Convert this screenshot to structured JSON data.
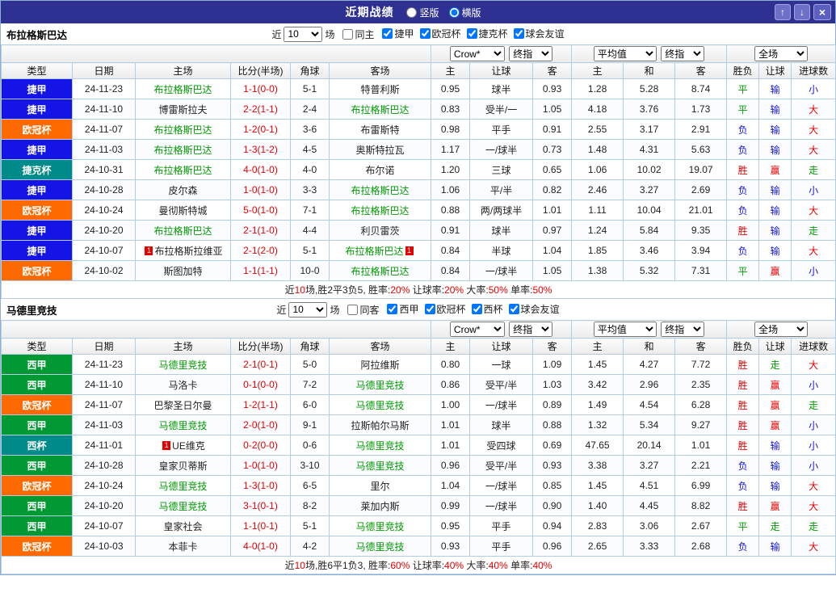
{
  "topbar": {
    "title": "近期战绩",
    "radios": [
      {
        "label": "竖版",
        "checked": false
      },
      {
        "label": "横版",
        "checked": true
      }
    ],
    "up_icon": "↑",
    "down_icon": "↓",
    "close_icon": "×"
  },
  "dropdowns": {
    "crow": "Crow*",
    "final1": "终指",
    "avg": "平均值",
    "final2": "终指",
    "full": "全场"
  },
  "columns": {
    "type": "类型",
    "date": "日期",
    "home": "主场",
    "score": "比分(半场)",
    "corner": "角球",
    "away": "客场",
    "odds_home": "主",
    "handicap": "让球",
    "odds_away": "客",
    "avg_home": "主",
    "avg_draw": "和",
    "avg_away": "客",
    "wl": "胜负",
    "hc": "让球",
    "goals": "进球数"
  },
  "sections": [
    {
      "team": "布拉格斯巴达",
      "filter": {
        "near_label": "近",
        "games_value": "10",
        "games_label": "场",
        "same_label": "同主",
        "same_checked": false,
        "leagues": [
          {
            "label": "捷甲",
            "checked": true
          },
          {
            "label": "欧冠杯",
            "checked": true
          },
          {
            "label": "捷克杯",
            "checked": true
          },
          {
            "label": "球会友谊",
            "checked": true
          }
        ]
      },
      "rows": [
        {
          "league": "捷甲",
          "league_color": "#1414e6",
          "date": "24-11-23",
          "home": "布拉格斯巴达",
          "home_subject": true,
          "score": "1-1(0-0)",
          "corner": "5-1",
          "away": "特普利斯",
          "away_subject": false,
          "odds_home": "0.95",
          "handicap": "球半",
          "odds_away": "0.93",
          "avg_home": "1.28",
          "avg_draw": "5.28",
          "avg_away": "8.74",
          "wl": "平",
          "wl_color": "green",
          "hc": "输",
          "hc_color": "blue",
          "goals": "小",
          "goals_color": "blue"
        },
        {
          "league": "捷甲",
          "league_color": "#1414e6",
          "date": "24-11-10",
          "home": "博雷斯拉夫",
          "home_subject": false,
          "score": "2-2(1-1)",
          "corner": "2-4",
          "away": "布拉格斯巴达",
          "away_subject": true,
          "odds_home": "0.83",
          "handicap": "受半/一",
          "odds_away": "1.05",
          "avg_home": "4.18",
          "avg_draw": "3.76",
          "avg_away": "1.73",
          "wl": "平",
          "wl_color": "green",
          "hc": "输",
          "hc_color": "blue",
          "goals": "大",
          "goals_color": "red"
        },
        {
          "league": "欧冠杯",
          "league_color": "#ff6a00",
          "date": "24-11-07",
          "home": "布拉格斯巴达",
          "home_subject": true,
          "score": "1-2(0-1)",
          "corner": "3-6",
          "away": "布雷斯特",
          "away_subject": false,
          "odds_home": "0.98",
          "handicap": "平手",
          "odds_away": "0.91",
          "avg_home": "2.55",
          "avg_draw": "3.17",
          "avg_away": "2.91",
          "wl": "负",
          "wl_color": "blue",
          "hc": "输",
          "hc_color": "blue",
          "goals": "大",
          "goals_color": "red"
        },
        {
          "league": "捷甲",
          "league_color": "#1414e6",
          "date": "24-11-03",
          "home": "布拉格斯巴达",
          "home_subject": true,
          "score": "1-3(1-2)",
          "corner": "4-5",
          "away": "奥斯特拉瓦",
          "away_subject": false,
          "odds_home": "1.17",
          "handicap": "一/球半",
          "odds_away": "0.73",
          "avg_home": "1.48",
          "avg_draw": "4.31",
          "avg_away": "5.63",
          "wl": "负",
          "wl_color": "blue",
          "hc": "输",
          "hc_color": "blue",
          "goals": "大",
          "goals_color": "red"
        },
        {
          "league": "捷克杯",
          "league_color": "#008b8b",
          "date": "24-10-31",
          "home": "布拉格斯巴达",
          "home_subject": true,
          "score": "4-0(1-0)",
          "corner": "4-0",
          "away": "布尔诺",
          "away_subject": false,
          "odds_home": "1.20",
          "handicap": "三球",
          "odds_away": "0.65",
          "avg_home": "1.06",
          "avg_draw": "10.02",
          "avg_away": "19.07",
          "wl": "胜",
          "wl_color": "red",
          "hc": "赢",
          "hc_color": "red",
          "goals": "走",
          "goals_color": "green"
        },
        {
          "league": "捷甲",
          "league_color": "#1414e6",
          "date": "24-10-28",
          "home": "皮尔森",
          "home_subject": false,
          "score": "1-0(1-0)",
          "corner": "3-3",
          "away": "布拉格斯巴达",
          "away_subject": true,
          "odds_home": "1.06",
          "handicap": "平/半",
          "odds_away": "0.82",
          "avg_home": "2.46",
          "avg_draw": "3.27",
          "avg_away": "2.69",
          "wl": "负",
          "wl_color": "blue",
          "hc": "输",
          "hc_color": "blue",
          "goals": "小",
          "goals_color": "blue"
        },
        {
          "league": "欧冠杯",
          "league_color": "#ff6a00",
          "date": "24-10-24",
          "home": "曼彻斯特城",
          "home_subject": false,
          "score": "5-0(1-0)",
          "corner": "7-1",
          "away": "布拉格斯巴达",
          "away_subject": true,
          "odds_home": "0.88",
          "handicap": "两/两球半",
          "odds_away": "1.01",
          "avg_home": "1.11",
          "avg_draw": "10.04",
          "avg_away": "21.01",
          "wl": "负",
          "wl_color": "blue",
          "hc": "输",
          "hc_color": "blue",
          "goals": "大",
          "goals_color": "red"
        },
        {
          "league": "捷甲",
          "league_color": "#1414e6",
          "date": "24-10-20",
          "home": "布拉格斯巴达",
          "home_subject": true,
          "score": "2-1(1-0)",
          "corner": "4-4",
          "away": "利贝雷茨",
          "away_subject": false,
          "odds_home": "0.91",
          "handicap": "球半",
          "odds_away": "0.97",
          "avg_home": "1.24",
          "avg_draw": "5.84",
          "avg_away": "9.35",
          "wl": "胜",
          "wl_color": "red",
          "hc": "输",
          "hc_color": "blue",
          "goals": "走",
          "goals_color": "green"
        },
        {
          "league": "捷甲",
          "league_color": "#1414e6",
          "date": "24-10-07",
          "home": "布拉格斯拉维亚",
          "home_subject": false,
          "home_badge_before": "1",
          "score": "2-1(2-0)",
          "corner": "5-1",
          "away": "布拉格斯巴达",
          "away_subject": true,
          "away_badge_after": "1",
          "odds_home": "0.84",
          "handicap": "半球",
          "odds_away": "1.04",
          "avg_home": "1.85",
          "avg_draw": "3.46",
          "avg_away": "3.94",
          "wl": "负",
          "wl_color": "blue",
          "hc": "输",
          "hc_color": "blue",
          "goals": "大",
          "goals_color": "red"
        },
        {
          "league": "欧冠杯",
          "league_color": "#ff6a00",
          "date": "24-10-02",
          "home": "斯图加特",
          "home_subject": false,
          "score": "1-1(1-1)",
          "corner": "10-0",
          "away": "布拉格斯巴达",
          "away_subject": true,
          "odds_home": "0.84",
          "handicap": "一/球半",
          "odds_away": "1.05",
          "avg_home": "1.38",
          "avg_draw": "5.32",
          "avg_away": "7.31",
          "wl": "平",
          "wl_color": "green",
          "hc": "赢",
          "hc_color": "red",
          "goals": "小",
          "goals_color": "blue"
        }
      ],
      "summary": [
        {
          "text": "近",
          "red": false
        },
        {
          "text": "10",
          "red": true
        },
        {
          "text": "场,胜2平3负5, 胜率:",
          "red": false
        },
        {
          "text": "20%",
          "red": true
        },
        {
          "text": " 让球率:",
          "red": false
        },
        {
          "text": "20%",
          "red": true
        },
        {
          "text": " 大率:",
          "red": false
        },
        {
          "text": "50%",
          "red": true
        },
        {
          "text": " 单率:",
          "red": false
        },
        {
          "text": "50%",
          "red": true
        }
      ]
    },
    {
      "team": "马德里竞技",
      "filter": {
        "near_label": "近",
        "games_value": "10",
        "games_label": "场",
        "same_label": "同客",
        "same_checked": false,
        "leagues": [
          {
            "label": "西甲",
            "checked": true
          },
          {
            "label": "欧冠杯",
            "checked": true
          },
          {
            "label": "西杯",
            "checked": true
          },
          {
            "label": "球会友谊",
            "checked": true
          }
        ]
      },
      "rows": [
        {
          "league": "西甲",
          "league_color": "#009933",
          "date": "24-11-23",
          "home": "马德里竞技",
          "home_subject": true,
          "score": "2-1(0-1)",
          "corner": "5-0",
          "away": "阿拉维斯",
          "away_subject": false,
          "odds_home": "0.80",
          "handicap": "一球",
          "odds_away": "1.09",
          "avg_home": "1.45",
          "avg_draw": "4.27",
          "avg_away": "7.72",
          "wl": "胜",
          "wl_color": "red",
          "hc": "走",
          "hc_color": "green",
          "goals": "大",
          "goals_color": "red"
        },
        {
          "league": "西甲",
          "league_color": "#009933",
          "date": "24-11-10",
          "home": "马洛卡",
          "home_subject": false,
          "score": "0-1(0-0)",
          "corner": "7-2",
          "away": "马德里竞技",
          "away_subject": true,
          "odds_home": "0.86",
          "handicap": "受平/半",
          "odds_away": "1.03",
          "avg_home": "3.42",
          "avg_draw": "2.96",
          "avg_away": "2.35",
          "wl": "胜",
          "wl_color": "red",
          "hc": "赢",
          "hc_color": "red",
          "goals": "小",
          "goals_color": "blue"
        },
        {
          "league": "欧冠杯",
          "league_color": "#ff6a00",
          "date": "24-11-07",
          "home": "巴黎圣日尔曼",
          "home_subject": false,
          "score": "1-2(1-1)",
          "corner": "6-0",
          "away": "马德里竞技",
          "away_subject": true,
          "odds_home": "1.00",
          "handicap": "一/球半",
          "odds_away": "0.89",
          "avg_home": "1.49",
          "avg_draw": "4.54",
          "avg_away": "6.28",
          "wl": "胜",
          "wl_color": "red",
          "hc": "赢",
          "hc_color": "red",
          "goals": "走",
          "goals_color": "green"
        },
        {
          "league": "西甲",
          "league_color": "#009933",
          "date": "24-11-03",
          "home": "马德里竞技",
          "home_subject": true,
          "score": "2-0(1-0)",
          "corner": "9-1",
          "away": "拉斯帕尔马斯",
          "away_subject": false,
          "odds_home": "1.01",
          "handicap": "球半",
          "odds_away": "0.88",
          "avg_home": "1.32",
          "avg_draw": "5.34",
          "avg_away": "9.27",
          "wl": "胜",
          "wl_color": "red",
          "hc": "赢",
          "hc_color": "red",
          "goals": "小",
          "goals_color": "blue"
        },
        {
          "league": "西杯",
          "league_color": "#008b8b",
          "date": "24-11-01",
          "home": "UE维克",
          "home_subject": false,
          "home_badge_before": "1",
          "score": "0-2(0-0)",
          "corner": "0-6",
          "away": "马德里竞技",
          "away_subject": true,
          "odds_home": "1.01",
          "handicap": "受四球",
          "odds_away": "0.69",
          "avg_home": "47.65",
          "avg_draw": "20.14",
          "avg_away": "1.01",
          "wl": "胜",
          "wl_color": "red",
          "hc": "输",
          "hc_color": "blue",
          "goals": "小",
          "goals_color": "blue"
        },
        {
          "league": "西甲",
          "league_color": "#009933",
          "date": "24-10-28",
          "home": "皇家贝蒂斯",
          "home_subject": false,
          "score": "1-0(1-0)",
          "corner": "3-10",
          "away": "马德里竞技",
          "away_subject": true,
          "odds_home": "0.96",
          "handicap": "受平/半",
          "odds_away": "0.93",
          "avg_home": "3.38",
          "avg_draw": "3.27",
          "avg_away": "2.21",
          "wl": "负",
          "wl_color": "blue",
          "hc": "输",
          "hc_color": "blue",
          "goals": "小",
          "goals_color": "blue"
        },
        {
          "league": "欧冠杯",
          "league_color": "#ff6a00",
          "date": "24-10-24",
          "home": "马德里竞技",
          "home_subject": true,
          "score": "1-3(1-0)",
          "corner": "6-5",
          "away": "里尔",
          "away_subject": false,
          "odds_home": "1.04",
          "handicap": "一/球半",
          "odds_away": "0.85",
          "avg_home": "1.45",
          "avg_draw": "4.51",
          "avg_away": "6.99",
          "wl": "负",
          "wl_color": "blue",
          "hc": "输",
          "hc_color": "blue",
          "goals": "大",
          "goals_color": "red"
        },
        {
          "league": "西甲",
          "league_color": "#009933",
          "date": "24-10-20",
          "home": "马德里竞技",
          "home_subject": true,
          "score": "3-1(0-1)",
          "corner": "8-2",
          "away": "莱加内斯",
          "away_subject": false,
          "odds_home": "0.99",
          "handicap": "一/球半",
          "odds_away": "0.90",
          "avg_home": "1.40",
          "avg_draw": "4.45",
          "avg_away": "8.82",
          "wl": "胜",
          "wl_color": "red",
          "hc": "赢",
          "hc_color": "red",
          "goals": "大",
          "goals_color": "red"
        },
        {
          "league": "西甲",
          "league_color": "#009933",
          "date": "24-10-07",
          "home": "皇家社会",
          "home_subject": false,
          "score": "1-1(0-1)",
          "corner": "5-1",
          "away": "马德里竞技",
          "away_subject": true,
          "odds_home": "0.95",
          "handicap": "平手",
          "odds_away": "0.94",
          "avg_home": "2.83",
          "avg_draw": "3.06",
          "avg_away": "2.67",
          "wl": "平",
          "wl_color": "green",
          "hc": "走",
          "hc_color": "green",
          "goals": "走",
          "goals_color": "green"
        },
        {
          "league": "欧冠杯",
          "league_color": "#ff6a00",
          "date": "24-10-03",
          "home": "本菲卡",
          "home_subject": false,
          "score": "4-0(1-0)",
          "corner": "4-2",
          "away": "马德里竞技",
          "away_subject": true,
          "odds_home": "0.93",
          "handicap": "平手",
          "odds_away": "0.96",
          "avg_home": "2.65",
          "avg_draw": "3.33",
          "avg_away": "2.68",
          "wl": "负",
          "wl_color": "blue",
          "hc": "输",
          "hc_color": "blue",
          "goals": "大",
          "goals_color": "red"
        }
      ],
      "summary": [
        {
          "text": "近",
          "red": false
        },
        {
          "text": "10",
          "red": true
        },
        {
          "text": "场,胜6平1负3, 胜率:",
          "red": false
        },
        {
          "text": "60%",
          "red": true
        },
        {
          "text": " 让球率:",
          "red": false
        },
        {
          "text": "40%",
          "red": true
        },
        {
          "text": " 大率:",
          "red": false
        },
        {
          "text": "40%",
          "red": true
        },
        {
          "text": " 单率:",
          "red": false
        },
        {
          "text": "40%",
          "red": true
        }
      ]
    }
  ]
}
